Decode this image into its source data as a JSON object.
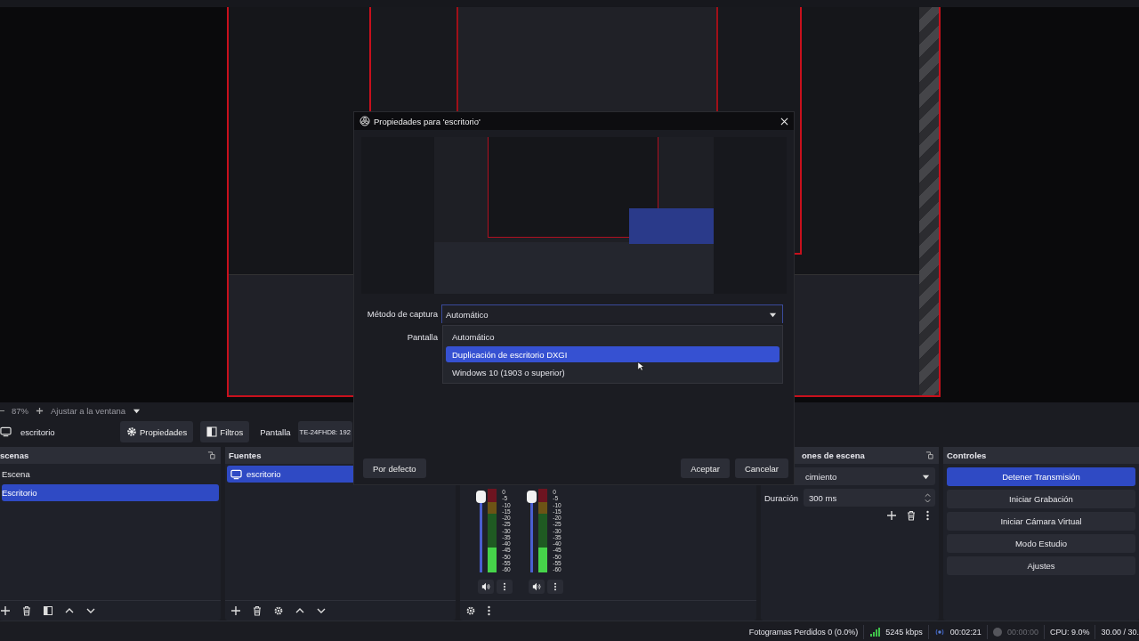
{
  "zoom_bar": {
    "zoom": "87%",
    "fit": "Ajustar a la ventana"
  },
  "source_toolbar": {
    "source": "escritorio",
    "buttons": [
      "Propiedades",
      "Filtros"
    ],
    "display_label": "Pantalla",
    "display_value": "TE-24FHD8: 192"
  },
  "scenes": {
    "title": "scenas",
    "items": [
      {
        "label": "Escena",
        "selected": false
      },
      {
        "label": "Escritorio",
        "selected": true
      }
    ]
  },
  "sources": {
    "title": "Fuentes",
    "items": [
      {
        "label": "escritorio",
        "selected": true
      }
    ]
  },
  "mixer": {
    "channels": [
      {
        "fader": {
          "level": 1
        },
        "meter": {
          "level": 0.3
        },
        "scale": [
          "0",
          "-5",
          "-10",
          "-15",
          "-20",
          "-25",
          "-30",
          "-35",
          "-40",
          "-45",
          "-50",
          "-55",
          "-60"
        ]
      },
      {
        "fader": {
          "level": 1
        },
        "meter": {
          "level": 0.3
        },
        "scale": [
          "0",
          "-5",
          "-10",
          "-15",
          "-20",
          "-25",
          "-30",
          "-35",
          "-40",
          "-45",
          "-50",
          "-55",
          "-60"
        ]
      }
    ]
  },
  "transitions": {
    "title": "ones de escena",
    "transition": "cimiento",
    "duration_label": "Duración",
    "duration": "300 ms"
  },
  "controls": {
    "title": "Controles",
    "buttons": [
      {
        "label": "Detener Transmisión",
        "active": true
      },
      {
        "label": "Iniciar Grabación",
        "active": false
      },
      {
        "label": "Iniciar Cámara Virtual",
        "active": false
      },
      {
        "label": "Modo Estudio",
        "active": false
      },
      {
        "label": "Ajustes",
        "active": false
      }
    ]
  },
  "status_bar": {
    "dropped": "Fotogramas Perdidos 0 (0.0%)",
    "bitrate": "5245 kbps",
    "stream_time": "00:02:21",
    "recording": false,
    "record_time": "00:00:00",
    "cpu": "CPU: 9.0%",
    "fps": "30.00 / 30."
  },
  "dialog": {
    "title": "Propiedades para 'escritorio'",
    "capture_label": "Método de captura",
    "capture_value": "Automático",
    "options": [
      {
        "label": "Automático",
        "selected": false
      },
      {
        "label": "Duplicación de escritorio DXGI",
        "selected": true
      },
      {
        "label": "Windows 10 (1903 o superior)",
        "selected": false
      }
    ],
    "display_label": "Pantalla",
    "defaults_button": "Por defecto",
    "ok_button": "Aceptar",
    "cancel_button": "Cancelar"
  }
}
